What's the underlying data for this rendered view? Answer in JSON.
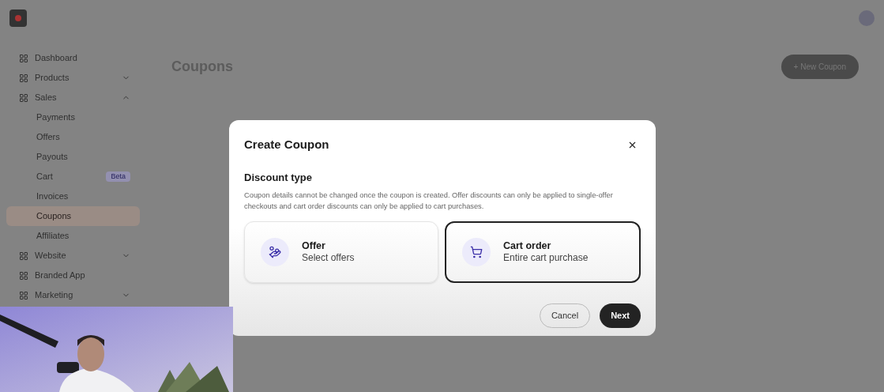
{
  "sidebar": {
    "items": [
      {
        "label": "Dashboard",
        "selected": false,
        "expandable": false
      },
      {
        "label": "Products",
        "selected": false,
        "expandable": true
      },
      {
        "label": "Sales",
        "selected": false,
        "expandable": true,
        "children": [
          {
            "label": "Payments",
            "selected": false
          },
          {
            "label": "Offers",
            "selected": false
          },
          {
            "label": "Payouts",
            "selected": false
          },
          {
            "label": "Cart",
            "selected": false,
            "badge": "Beta"
          },
          {
            "label": "Invoices",
            "selected": false
          },
          {
            "label": "Coupons",
            "selected": true
          },
          {
            "label": "Affiliates",
            "selected": false
          }
        ]
      },
      {
        "label": "Website",
        "selected": false,
        "expandable": true
      },
      {
        "label": "Branded App",
        "selected": false,
        "expandable": false
      },
      {
        "label": "Marketing",
        "selected": false,
        "expandable": true
      }
    ]
  },
  "page": {
    "title": "Coupons",
    "new_button": "+ New Coupon"
  },
  "dialog": {
    "title": "Create Coupon",
    "section_title": "Discount type",
    "description": "Coupon details cannot be changed once the coupon is created. Offer discounts can only be applied to single-offer checkouts and cart order discounts can only be applied to cart purchases.",
    "options": [
      {
        "kind": "offer",
        "title": "Offer",
        "subtitle": "Select offers",
        "selected": false
      },
      {
        "kind": "cart",
        "title": "Cart order",
        "subtitle": "Entire cart purchase",
        "selected": true
      }
    ],
    "buttons": [
      {
        "kind": "secondary",
        "label": "Cancel"
      },
      {
        "kind": "primary",
        "label": "Next"
      }
    ]
  }
}
